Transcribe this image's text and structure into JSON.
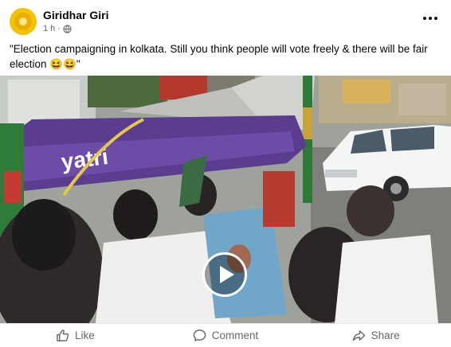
{
  "post": {
    "author": "Giridhar Giri",
    "time": "1 h",
    "separator": "·",
    "caption": "\"Election campaigning in kolkata. Still you think  people will vote     freely  &  there will be fair election 😆😆\""
  },
  "video": {
    "overlay_text": "yatri"
  },
  "actions": {
    "like": "Like",
    "comment": "Comment",
    "share": "Share"
  },
  "icons": {
    "avatar": "avatar",
    "audience": "globe-icon",
    "menu": "more-options-icon",
    "play": "play-icon",
    "like": "thumbs-up-icon",
    "comment": "comment-bubble-icon",
    "share": "share-arrow-icon"
  },
  "colors": {
    "text": "#050505",
    "secondary_text": "#65676b",
    "avatar_bg": "#f2c400",
    "divider": "#e4e6eb"
  }
}
